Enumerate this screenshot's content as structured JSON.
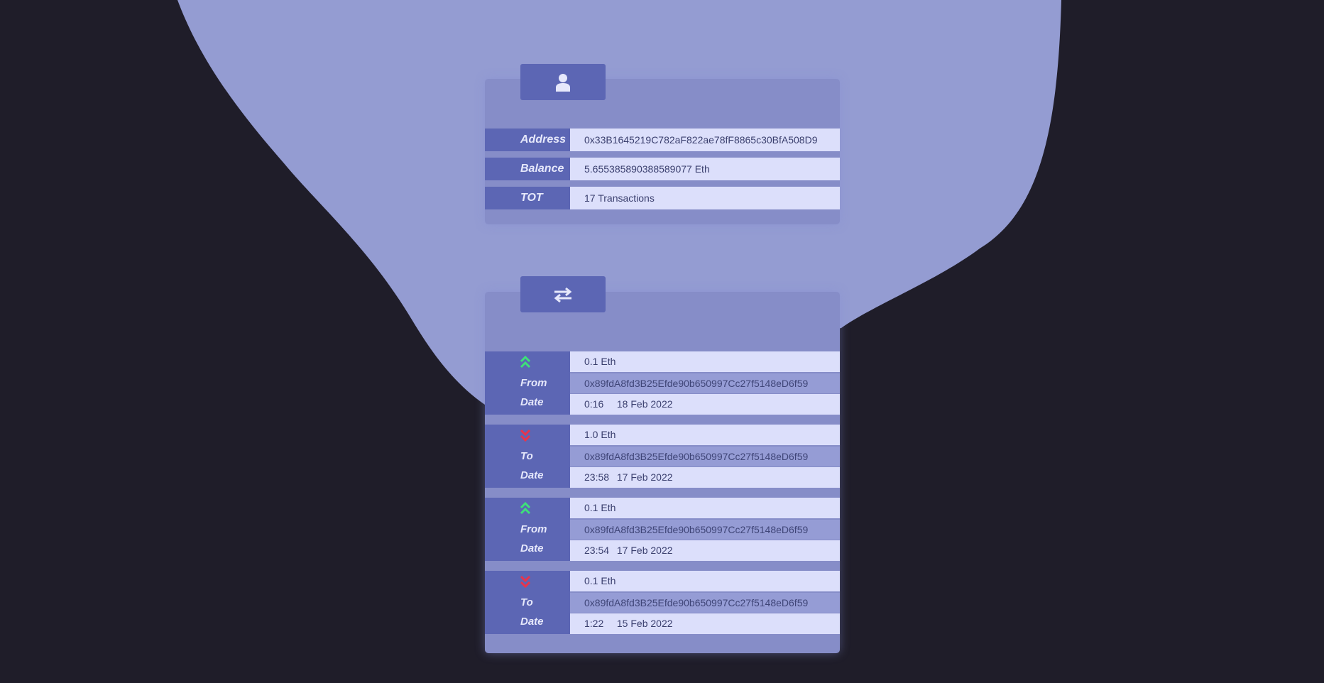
{
  "account": {
    "icon": "user-icon",
    "rows": [
      {
        "label": "Address",
        "value": "0x33B1645219C782aF822ae78fF8865c30BfA508D9"
      },
      {
        "label": "Balance",
        "value": "5.655385890388589077 Eth"
      },
      {
        "label": "TOT",
        "value": "17 Transactions"
      }
    ]
  },
  "transactions_panel": {
    "icon": "swap-arrows-icon"
  },
  "transactions": [
    {
      "direction": "incoming",
      "arrow_icon": "double-chevron-up-icon",
      "party_label": "From",
      "date_label": "Date",
      "amount": "0.1 Eth",
      "address": "0x89fdA8fd3B25Efde90b650997Cc27f5148eD6f59",
      "time": "0:16",
      "date": "18 Feb 2022"
    },
    {
      "direction": "outgoing",
      "arrow_icon": "double-chevron-down-icon",
      "party_label": "To",
      "date_label": "Date",
      "amount": "1.0 Eth",
      "address": "0x89fdA8fd3B25Efde90b650997Cc27f5148eD6f59",
      "time": "23:58",
      "date": "17 Feb 2022"
    },
    {
      "direction": "incoming",
      "arrow_icon": "double-chevron-up-icon",
      "party_label": "From",
      "date_label": "Date",
      "amount": "0.1 Eth",
      "address": "0x89fdA8fd3B25Efde90b650997Cc27f5148eD6f59",
      "time": "23:54",
      "date": "17 Feb 2022"
    },
    {
      "direction": "outgoing",
      "arrow_icon": "double-chevron-down-icon",
      "party_label": "To",
      "date_label": "Date",
      "amount": "0.1 Eth",
      "address": "0x89fdA8fd3B25Efde90b650997Cc27f5148eD6f59",
      "time": "1:22",
      "date": "15 Feb 2022"
    }
  ],
  "colors": {
    "background": "#1f1d29",
    "blob": "#949cd2",
    "card": "#868dc8",
    "label_bg": "#5c66b4",
    "value_bg": "#dcdffb",
    "incoming_arrow": "#3ee07a",
    "outgoing_arrow": "#e8344c"
  }
}
